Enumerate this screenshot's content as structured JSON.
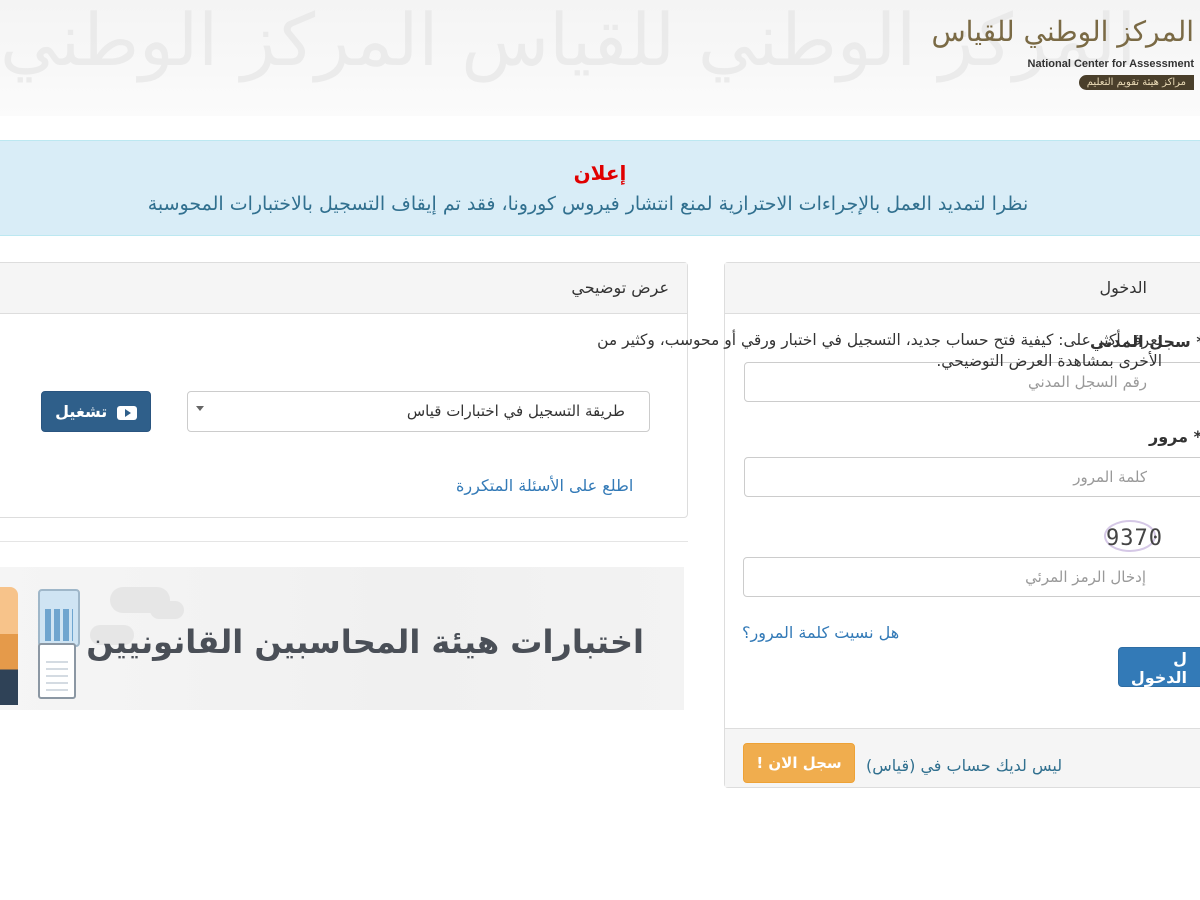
{
  "header": {
    "pattern_text": "المركز الوطني للقياس المركز الوطني",
    "logo": {
      "arabic_name": "المركز الوطني للقياس",
      "english_name": "National Center for Assessment",
      "subtitle": "مراكز هيئة تقويم التعليم"
    }
  },
  "announcement": {
    "title": "إعلان",
    "text": "نظرا لتمديد العمل بالإجراءات الاحترازية لمنع انتشار فيروس كورونا، فقد تم إيقاف التسجيل بالاختبارات المحوسبة"
  },
  "login": {
    "heading": "الدخول",
    "civil_id_label": "سجل المدني",
    "civil_id_placeholder": "رقم السجل المدني",
    "password_label": "مرور",
    "password_placeholder": "كلمة المرور",
    "required_mark": "*",
    "captcha_text": "9370",
    "captcha_placeholder": "إدخال الرمز المرئي",
    "forgot_password": "هل نسيت كلمة المرور؟",
    "login_button": "ل الدخول",
    "no_account_text": "ليس لديك حساب في (قياس)",
    "register_button": "سجل الان !"
  },
  "demo": {
    "heading": "عرض توضيحي",
    "description_line1": "تعرف أكثر على: كيفية فتح حساب جديد، التسجيل في اختبار ورقي أو محوسب، وكثير من",
    "description_line2": "الأخرى بمشاهدة العرض التوضيحي.",
    "select_value": "طريقة التسجيل في اختبارات قياس",
    "play_button": "تشغيل",
    "faq_link": "اطلع على الأسئلة المتكررة"
  },
  "banner": {
    "text": "اختبارات هيئة المحاسبين القانونيين"
  },
  "colors": {
    "announcement_bg": "#d9edf7",
    "announcement_title": "#e00000",
    "primary": "#337ab7",
    "warning": "#f0ad4e",
    "play_button": "#2f5f8a"
  }
}
